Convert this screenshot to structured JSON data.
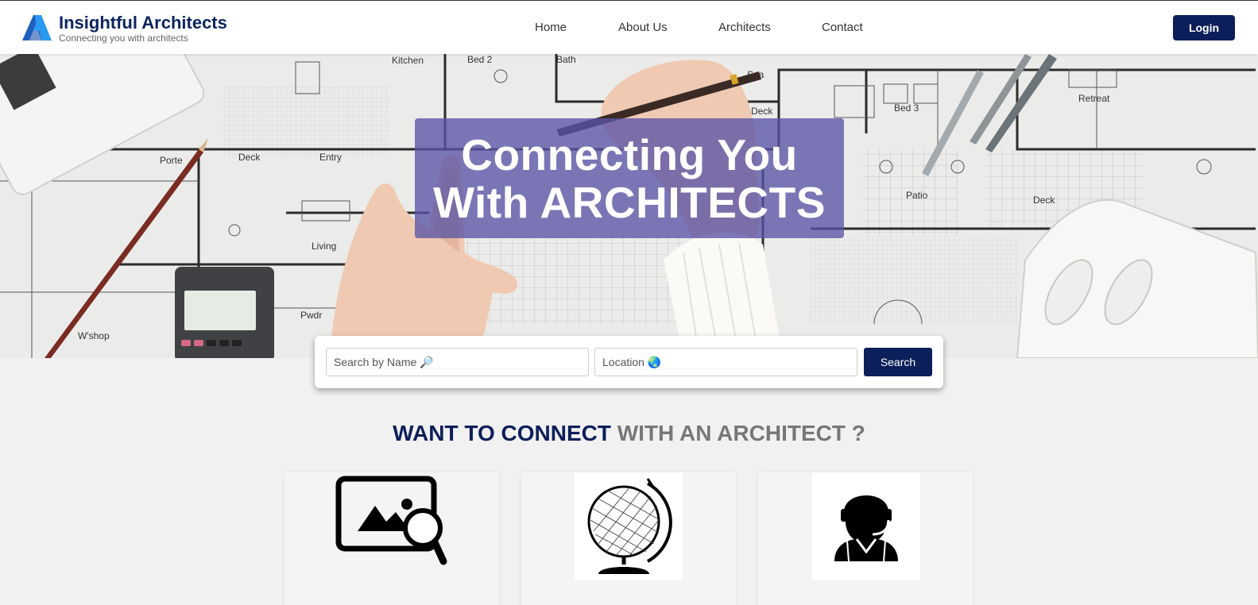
{
  "brand": {
    "title": "Insightful Architects",
    "subtitle": "Connecting you with architects"
  },
  "nav": {
    "items": [
      "Home",
      "About Us",
      "Architects",
      "Contact"
    ],
    "login_label": "Login"
  },
  "hero": {
    "line1": "Connecting You",
    "line2": "With ARCHITECTS",
    "plan_labels": [
      "Kitchen",
      "Bed 2",
      "Bath",
      "Spa",
      "Deck",
      "Bed 3",
      "Retreat",
      "Porte",
      "Entry",
      "Deck",
      "Living",
      "Pwdr",
      "W'shop",
      "Patio",
      "Deck"
    ]
  },
  "search": {
    "name_placeholder": "Search by Name 🔎",
    "location_placeholder": "Location 🌏",
    "button_label": "Search"
  },
  "section": {
    "heading_dark": "WANT TO CONNECT",
    "heading_grey": " WITH AN ARCHITECT ?"
  },
  "cards": [
    {
      "icon": "image-search-icon"
    },
    {
      "icon": "globe-icon"
    },
    {
      "icon": "support-agent-icon"
    }
  ],
  "colors": {
    "primary": "#0c1f5a",
    "hero_overlay": "#5a55a5",
    "heading_grey": "#777777"
  }
}
